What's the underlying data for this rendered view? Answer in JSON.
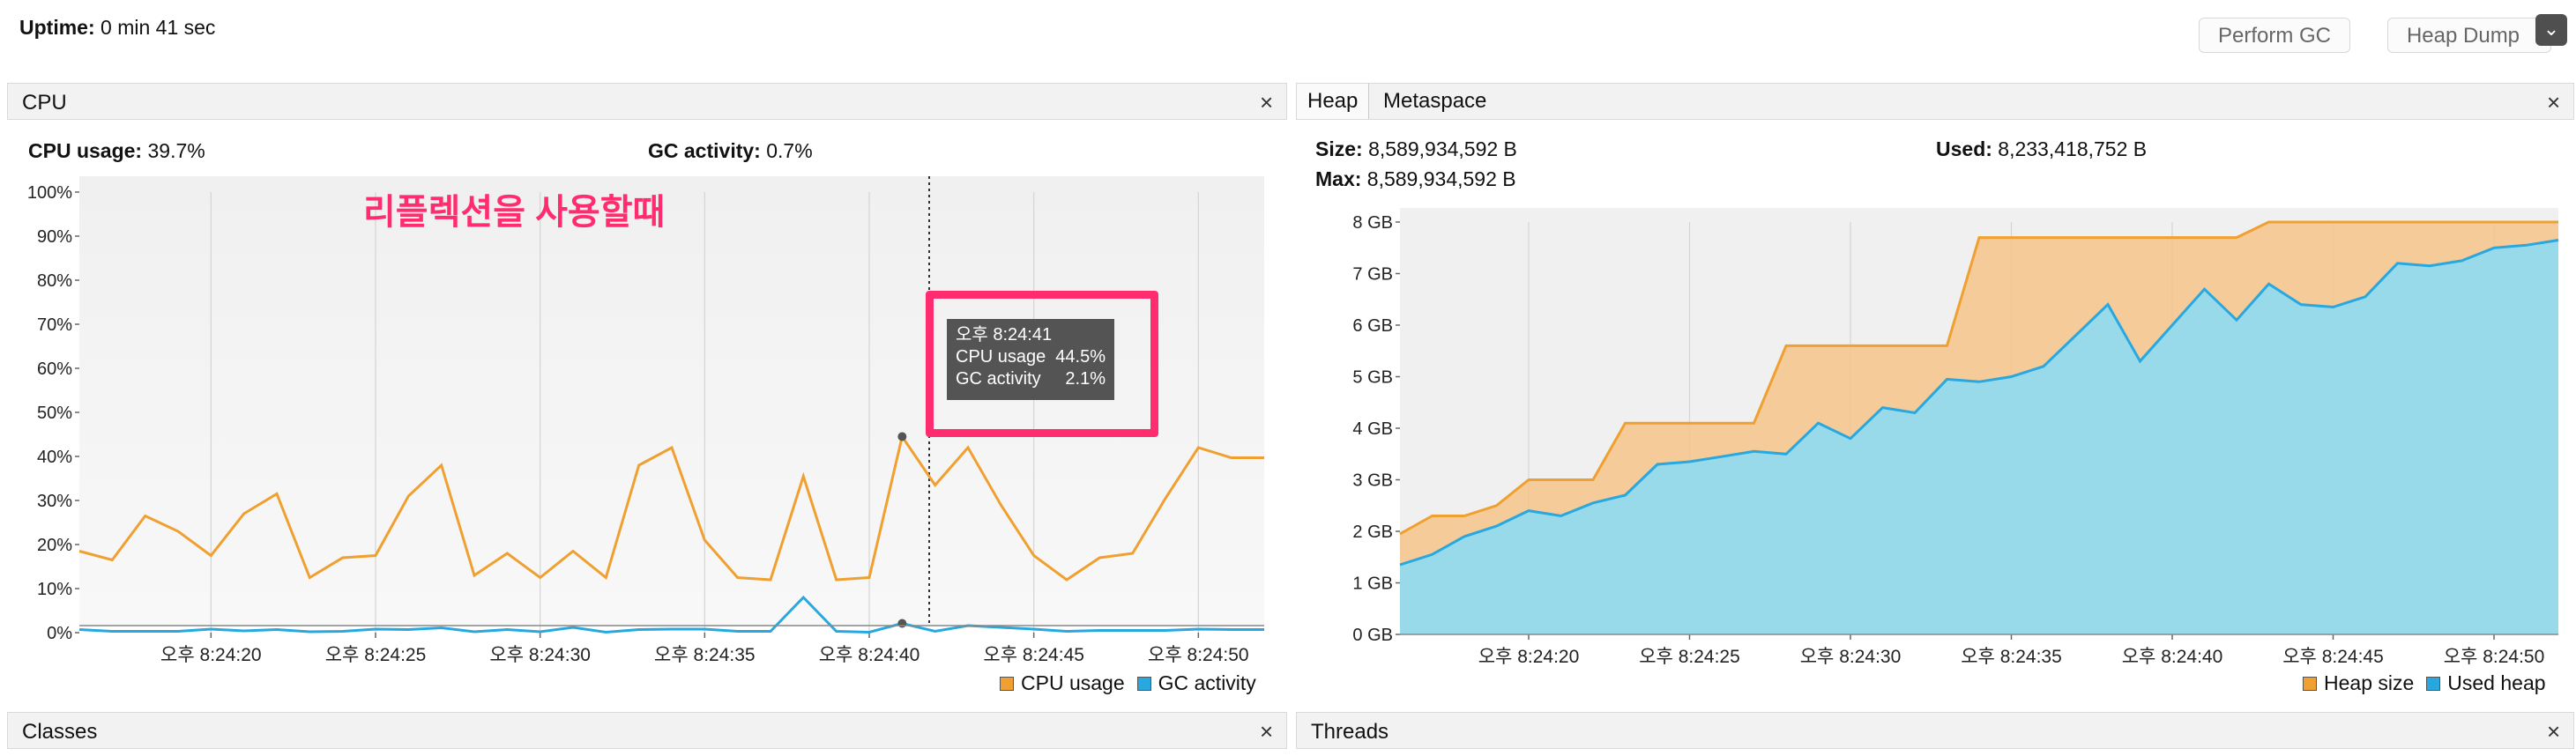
{
  "top": {
    "uptime_label": "Uptime:",
    "uptime_value": "0 min 41 sec",
    "perform_gc": "Perform GC",
    "heap_dump": "Heap Dump",
    "dropdown_glyph": "⌄"
  },
  "cpu_panel": {
    "title": "CPU",
    "close": "×",
    "cpu_usage_label": "CPU usage:",
    "cpu_usage_value": "39.7%",
    "gc_activity_label": "GC activity:",
    "gc_activity_value": "0.7%",
    "annotation": "리플렉션을 사용할때",
    "tooltip": {
      "time": "오후 8:24:41",
      "cpu_label": "CPU usage",
      "cpu_value": "44.5%",
      "gc_label": "GC activity",
      "gc_value": "2.1%"
    },
    "legend": {
      "cpu": "CPU usage",
      "gc": "GC activity"
    }
  },
  "heap_panel": {
    "tabs": [
      "Heap",
      "Metaspace"
    ],
    "close": "×",
    "size_label": "Size:",
    "size_value": "8,589,934,592 B",
    "used_label": "Used:",
    "used_value": "8,233,418,752 B",
    "max_label": "Max:",
    "max_value": "8,589,934,592 B",
    "legend": {
      "size": "Heap size",
      "used": "Used heap"
    }
  },
  "bottom": {
    "classes_title": "Classes",
    "threads_title": "Threads",
    "close": "×"
  },
  "colors": {
    "cpu_line": "#f0a030",
    "gc_line": "#29a8e0",
    "heap_size": "#f6c48a",
    "used_heap": "#8fdcf3",
    "annotation": "#ff2d6f"
  },
  "chart_data": [
    {
      "type": "line",
      "ylim": [
        0,
        100
      ],
      "yticks": [
        "0%",
        "10%",
        "20%",
        "30%",
        "40%",
        "50%",
        "60%",
        "70%",
        "80%",
        "90%",
        "100%"
      ],
      "xticks": [
        "오후 8:24:20",
        "오후 8:24:25",
        "오후 8:24:30",
        "오후 8:24:35",
        "오후 8:24:40",
        "오후 8:24:45",
        "오후 8:24:50"
      ],
      "x": [
        16,
        17,
        18,
        19,
        20,
        21,
        22,
        23,
        24,
        25,
        26,
        27,
        28,
        29,
        30,
        31,
        32,
        33,
        34,
        35,
        36,
        37,
        38,
        39,
        40,
        41,
        42,
        43,
        44,
        45,
        46,
        47,
        48,
        49,
        50,
        51,
        52
      ],
      "series": [
        {
          "name": "CPU usage",
          "values": [
            18.5,
            16.5,
            26.5,
            23,
            17.5,
            27,
            31.5,
            12.5,
            17,
            17.5,
            31,
            38,
            13,
            18,
            12.5,
            18.5,
            12.5,
            38,
            42,
            21,
            12.5,
            12,
            35.5,
            12,
            12.5,
            44.5,
            33.5,
            42,
            29,
            17.5,
            12,
            17,
            18,
            30.5,
            42,
            39.7,
            39.7
          ]
        },
        {
          "name": "GC activity",
          "values": [
            0.7,
            0.3,
            0.3,
            0.3,
            0.8,
            0.4,
            0.7,
            0.2,
            0.3,
            0.8,
            0.7,
            1.1,
            0.2,
            0.7,
            0.2,
            1.2,
            0.1,
            0.7,
            0.8,
            0.8,
            0.3,
            0.3,
            8,
            0.3,
            0.1,
            2.1,
            0.3,
            1.6,
            1.2,
            0.8,
            0.3,
            0.5,
            0.5,
            0.5,
            0.8,
            0.7,
            0.7
          ]
        }
      ]
    },
    {
      "type": "area",
      "ylim": [
        0,
        8
      ],
      "yticks": [
        "0 GB",
        "1 GB",
        "2 GB",
        "3 GB",
        "4 GB",
        "5 GB",
        "6 GB",
        "7 GB",
        "8 GB"
      ],
      "xticks": [
        "오후 8:24:20",
        "오후 8:24:25",
        "오후 8:24:30",
        "오후 8:24:35",
        "오후 8:24:40",
        "오후 8:24:45",
        "오후 8:24:50"
      ],
      "x": [
        16,
        17,
        18,
        19,
        20,
        21,
        22,
        23,
        24,
        25,
        26,
        27,
        28,
        29,
        30,
        31,
        32,
        33,
        34,
        35,
        36,
        37,
        38,
        39,
        40,
        41,
        42,
        43,
        44,
        45,
        46,
        47,
        48,
        49,
        50,
        51,
        52
      ],
      "series": [
        {
          "name": "Heap size",
          "values": [
            1.95,
            2.3,
            2.3,
            2.5,
            3.0,
            3.0,
            3.0,
            4.1,
            4.1,
            4.1,
            4.1,
            4.1,
            5.6,
            5.6,
            5.6,
            5.6,
            5.6,
            5.6,
            7.7,
            7.7,
            7.7,
            7.7,
            7.7,
            7.7,
            7.7,
            7.7,
            7.7,
            8.0,
            8.0,
            8.0,
            8.0,
            8.0,
            8.0,
            8.0,
            8.0,
            8.0,
            8.0
          ]
        },
        {
          "name": "Used heap",
          "values": [
            1.35,
            1.55,
            1.9,
            2.1,
            2.4,
            2.3,
            2.55,
            2.7,
            3.3,
            3.35,
            3.45,
            3.55,
            3.5,
            4.1,
            3.8,
            4.4,
            4.3,
            4.95,
            4.9,
            5.0,
            5.2,
            5.8,
            6.4,
            5.3,
            6.0,
            6.7,
            6.1,
            6.8,
            6.4,
            6.35,
            6.55,
            7.2,
            7.15,
            7.25,
            7.5,
            7.55,
            7.65
          ]
        }
      ]
    }
  ]
}
